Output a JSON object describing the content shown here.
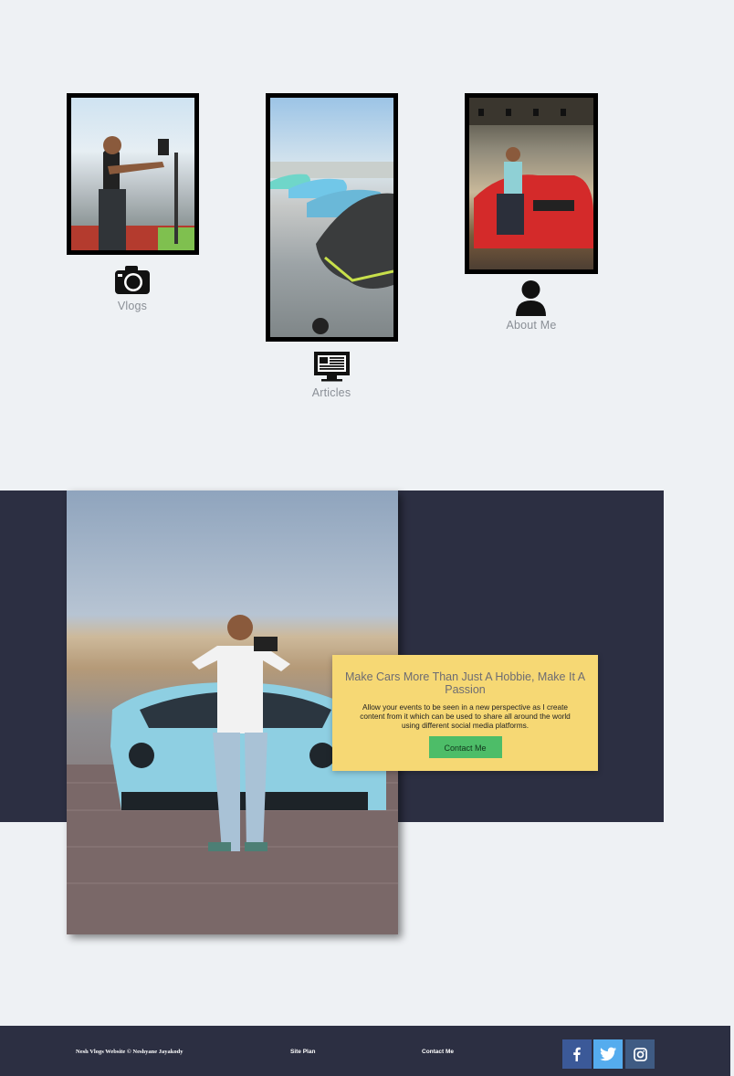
{
  "tiles": {
    "vlogs": {
      "label": "Vlogs",
      "icon": "camera-icon"
    },
    "articles": {
      "label": "Articles",
      "icon": "monitor-icon"
    },
    "about": {
      "label": "About Me",
      "icon": "user-icon"
    }
  },
  "hero": {
    "title": "Make Cars More Than Just A Hobbie, Make It A Passion",
    "text": "Allow your events to be seen in a new perspective as I create content from it which can be used to share all around the world using different social media platforms.",
    "button_label": "Contact Me"
  },
  "footer": {
    "copyright": "Nesh Vlogs Website © Neshyane Jayakody",
    "site_plan": "Site Plan",
    "contact": "Contact Me",
    "social": [
      {
        "icon": "facebook-icon",
        "color": "#3b5998"
      },
      {
        "icon": "twitter-icon",
        "color": "#55acee"
      },
      {
        "icon": "instagram-icon",
        "color": "#3f5b83"
      }
    ]
  },
  "colors": {
    "page_bg": "#eef1f4",
    "band_bg": "#2c2f42",
    "card_bg": "#f6d874",
    "button_bg": "#4dbd68"
  }
}
